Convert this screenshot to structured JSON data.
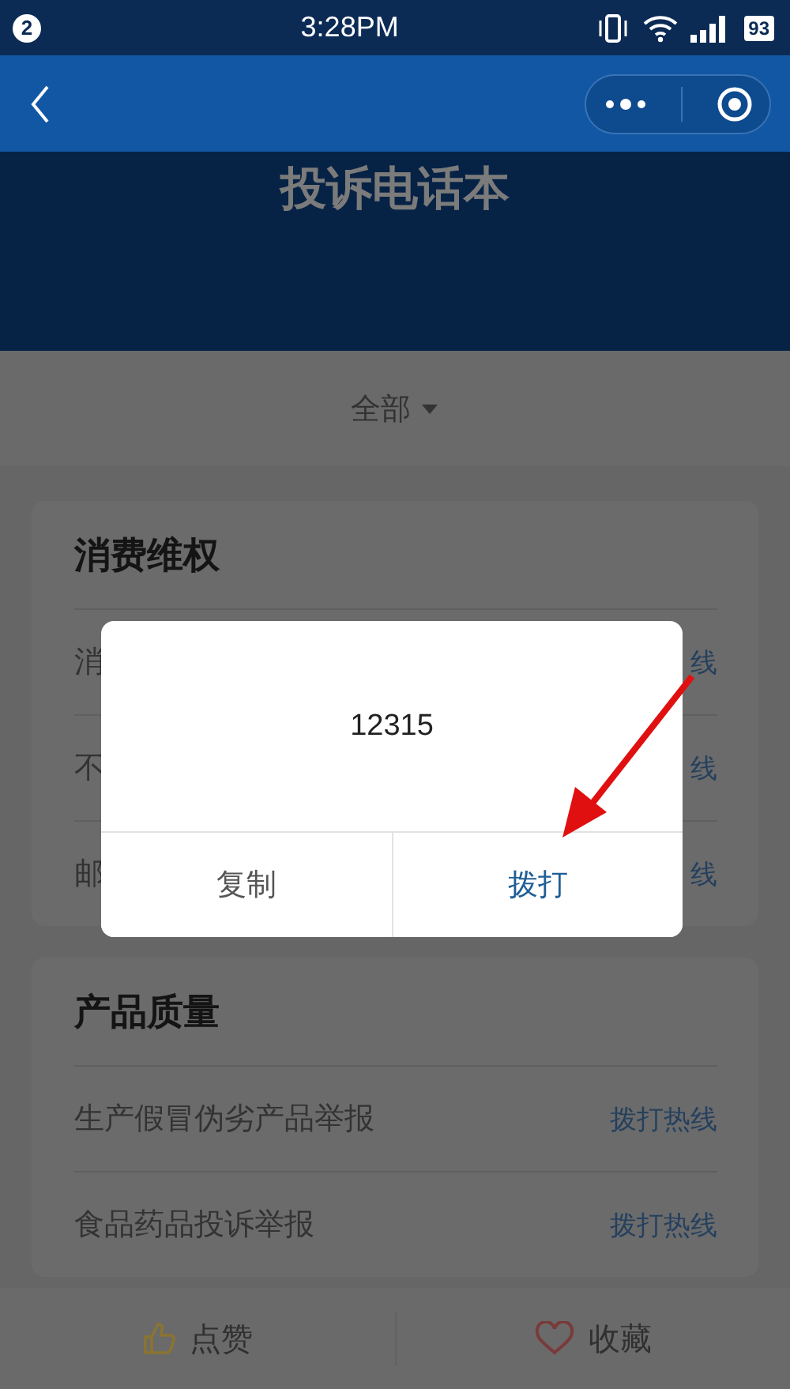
{
  "status_bar": {
    "notification_count": "2",
    "time": "3:28PM",
    "battery": "93"
  },
  "header": {
    "title": "投诉电话本"
  },
  "filter": {
    "label": "全部"
  },
  "sections": [
    {
      "title": "消费维权",
      "rows": [
        {
          "label": "消",
          "action": "线"
        },
        {
          "label": "不",
          "action": "线"
        },
        {
          "label": "邮",
          "action": "线"
        }
      ]
    },
    {
      "title": "产品质量",
      "rows": [
        {
          "label": "生产假冒伪劣产品举报",
          "action": "拨打热线"
        },
        {
          "label": "食品药品投诉举报",
          "action": "拨打热线"
        }
      ]
    }
  ],
  "dialog": {
    "content": "12315",
    "buttons": [
      {
        "label": "复制",
        "kind": "secondary"
      },
      {
        "label": "拨打",
        "kind": "primary"
      }
    ]
  },
  "bottom_bar": [
    {
      "label": "点赞",
      "kind": "like"
    },
    {
      "label": "收藏",
      "kind": "favorite"
    }
  ]
}
